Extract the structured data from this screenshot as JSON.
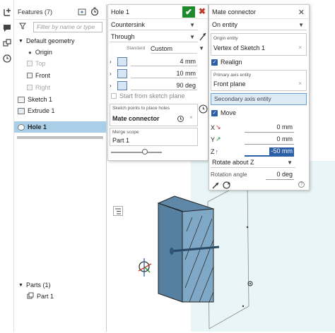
{
  "toolbar_left": {
    "icons": [
      "axis-plus-icon",
      "chat-icon",
      "cubes-icon",
      "clock-icon"
    ]
  },
  "features": {
    "title": "Features (7)",
    "filter_placeholder": "Filter by name or type",
    "tree": [
      {
        "label": "Default geometry",
        "disabled": false
      },
      {
        "label": "Origin",
        "disabled": false
      },
      {
        "label": "Top",
        "disabled": true
      },
      {
        "label": "Front",
        "disabled": false
      },
      {
        "label": "Right",
        "disabled": true
      },
      {
        "label": "Sketch 1",
        "disabled": false
      },
      {
        "label": "Extrude 1",
        "disabled": false
      },
      {
        "label": "Hole 1",
        "disabled": false,
        "selected": true
      }
    ]
  },
  "parts": {
    "title": "Parts (1)",
    "items": [
      "Part 1"
    ]
  },
  "hole": {
    "title": "Hole 1",
    "hole_type": "Countersink",
    "termination": "Through",
    "standard_label": "Standard",
    "standard_value": "Custom",
    "diameter": "4 mm",
    "countersink_diameter": "10 mm",
    "countersink_angle": "90 deg",
    "start_from_sketch_plane": "Start from sketch plane",
    "sketch_points_label": "Sketch points to place holes",
    "sketch_points_value": "Mate connector",
    "merge_scope_label": "Merge scope",
    "merge_scope_value": "Part 1"
  },
  "mate": {
    "title": "Mate connector",
    "placement": "On entity",
    "origin_label": "Origin entity",
    "origin_value": "Vertex of Sketch 1",
    "realign": "Realign",
    "primary_label": "Primary axis entity",
    "primary_value": "Front plane",
    "secondary_value": "Secondary axis entity",
    "move": "Move",
    "x_label": "X",
    "x_value": "0 mm",
    "y_label": "Y",
    "y_value": "0 mm",
    "z_label": "Z",
    "z_value": "-50 mm",
    "rotate_value": "Rotate about Z",
    "rotation_label": "Rotation angle",
    "rotation_value": "0 deg"
  },
  "colors": {
    "accent": "#2c5fa8",
    "ok": "#1d8a2b",
    "selection": "#a9cfe8",
    "part_face": "#7fa7c6"
  }
}
